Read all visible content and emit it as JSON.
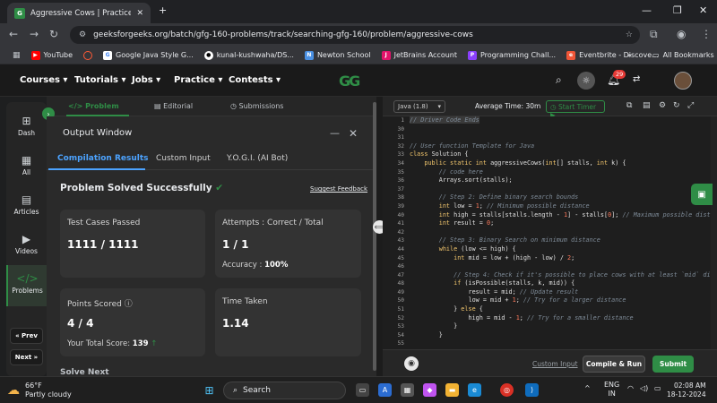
{
  "browser": {
    "tab_title": "Aggressive Cows | Practice | Ge",
    "url": "geeksforgeeks.org/batch/gfg-160-problems/track/searching-gfg-160/problem/aggressive-cows",
    "bookmarks": [
      "YouTube",
      "Google Java Style G...",
      "kunal-kushwaha/DS...",
      "Newton School",
      "JetBrains Account",
      "Programming Chall...",
      "Eventbrite - Discove..."
    ],
    "all_bookmarks": "All Bookmarks"
  },
  "site_nav": {
    "items": [
      "Courses",
      "Tutorials",
      "Jobs",
      "Practice",
      "Contests"
    ],
    "logo": "GG",
    "notif_count": "29"
  },
  "rail": {
    "items": [
      "Dash",
      "All",
      "Articles",
      "Videos",
      "Problems"
    ],
    "prev": "« Prev",
    "next": "Next »"
  },
  "panel_tabs": [
    "Problem",
    "Editorial",
    "Submissions"
  ],
  "output": {
    "title": "Output Window",
    "tabs": [
      "Compilation Results",
      "Custom Input",
      "Y.O.G.I. (AI Bot)"
    ],
    "status": "Problem Solved Successfully",
    "feedback": "Suggest Feedback",
    "cards": {
      "tests_label": "Test Cases Passed",
      "tests_value": "1111 / 1111",
      "attempts_label": "Attempts : Correct / Total",
      "attempts_value": "1 / 1",
      "accuracy_label": "Accuracy :",
      "accuracy_value": "100%",
      "points_label": "Points Scored",
      "points_value": "4 / 4",
      "total_label": "Your Total Score:",
      "total_value": "139",
      "time_label": "Time Taken",
      "time_value": "1.14"
    },
    "solve_next": "Solve Next"
  },
  "editor": {
    "language": "Java (1.8)",
    "avg_time": "Average Time: 30m",
    "timer": "Start Timer",
    "line_numbers": [
      "1",
      "30",
      "31",
      "32",
      "33",
      "34",
      "35",
      "36",
      "37",
      "38",
      "39",
      "40",
      "41",
      "42",
      "43",
      "44",
      "45",
      "46",
      "47",
      "48",
      "49",
      "50",
      "51",
      "52",
      "53",
      "54",
      "55",
      "56"
    ],
    "lines": [
      "// Driver Code Ends",
      "",
      "",
      "// User function Template for Java",
      "class Solution {",
      "    public static int aggressiveCows(int[] stalls, int k) {",
      "        // code here",
      "        Arrays.sort(stalls);",
      "",
      "        // Step 2: Define binary search bounds",
      "        int low = 1; // Minimum possible distance",
      "        int high = stalls[stalls.length - 1] - stalls[0]; // Maximum possible dist",
      "        int result = 0;",
      "",
      "        // Step 3: Binary Search on minimum distance",
      "        while (low <= high) {",
      "            int mid = low + (high - low) / 2;",
      "",
      "            // Step 4: Check if it's possible to place cows with at least `mid` di",
      "            if (isPossible(stalls, k, mid)) {",
      "                result = mid; // Update result",
      "                low = mid + 1; // Try for a larger distance",
      "            } else {",
      "                high = mid - 1; // Try for a smaller distance",
      "            }",
      "        }",
      "",
      ""
    ],
    "custom_input": "Custom Input",
    "compile": "Compile & Run",
    "submit": "Submit"
  },
  "taskbar": {
    "temp": "66°F",
    "weather": "Partly cloudy",
    "search": "Search",
    "lang1": "ENG",
    "lang2": "IN",
    "time": "02:08 AM",
    "date": "18-12-2024"
  },
  "colors": {
    "gfg_green": "#2f8d46",
    "accent_blue": "#4ca3ff",
    "panel_bg": "#2a2a2a"
  }
}
